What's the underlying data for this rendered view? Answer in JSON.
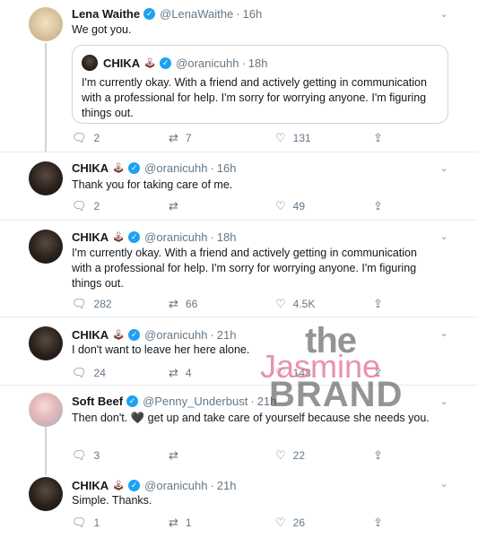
{
  "tweets": [
    {
      "name": "Lena Waithe",
      "handle": "@LenaWaithe",
      "time": "16h",
      "text": "We got you.",
      "quote": {
        "name": "CHIKA",
        "emoji": "🕹",
        "handle": "@oranicuhh",
        "time": "18h",
        "text": "I'm currently okay. With a friend and actively getting in communication with a professional for help. I'm sorry for worrying anyone. I'm figuring things out."
      },
      "replies": "2",
      "retweets": "7",
      "likes": "131"
    },
    {
      "name": "CHIKA",
      "emoji": "🕹",
      "handle": "@oranicuhh",
      "time": "16h",
      "text": "Thank you for taking care of me.",
      "replies": "2",
      "retweets": "",
      "likes": "49"
    },
    {
      "name": "CHIKA",
      "emoji": "🕹",
      "handle": "@oranicuhh",
      "time": "18h",
      "text": "I'm currently okay. With a friend and actively getting in communication with a professional for help. I'm sorry for worrying anyone. I'm figuring things out.",
      "replies": "282",
      "retweets": "66",
      "likes": "4.5K"
    },
    {
      "name": "CHIKA",
      "emoji": "🕹",
      "handle": "@oranicuhh",
      "time": "21h",
      "text": "I don't want to leave her here alone.",
      "replies": "24",
      "retweets": "4",
      "likes": "143"
    },
    {
      "name": "Soft Beef",
      "handle": "@Penny_Underbust",
      "time": "21h",
      "text": "Then don't. 🖤 get up and take care of yourself because she needs you.",
      "replies": "3",
      "retweets": "",
      "likes": "22"
    },
    {
      "name": "CHIKA",
      "emoji": "🕹",
      "handle": "@oranicuhh",
      "time": "21h",
      "text": "Simple. Thanks.",
      "replies": "1",
      "retweets": "1",
      "likes": "26"
    }
  ],
  "icons": {
    "reply": "reply-icon",
    "retweet": "retweet-icon",
    "like": "like-icon",
    "share": "share-icon",
    "more": "chevron-down-icon",
    "verified": "verified-badge-icon"
  },
  "watermark": {
    "line1": "the",
    "line2": "Jasmine",
    "line3": "BRAND"
  },
  "colors": {
    "verified": "#1da1f2",
    "secondary_text": "#657786",
    "divider": "#e6ecf0",
    "watermark_pink": "#e46e8c"
  }
}
